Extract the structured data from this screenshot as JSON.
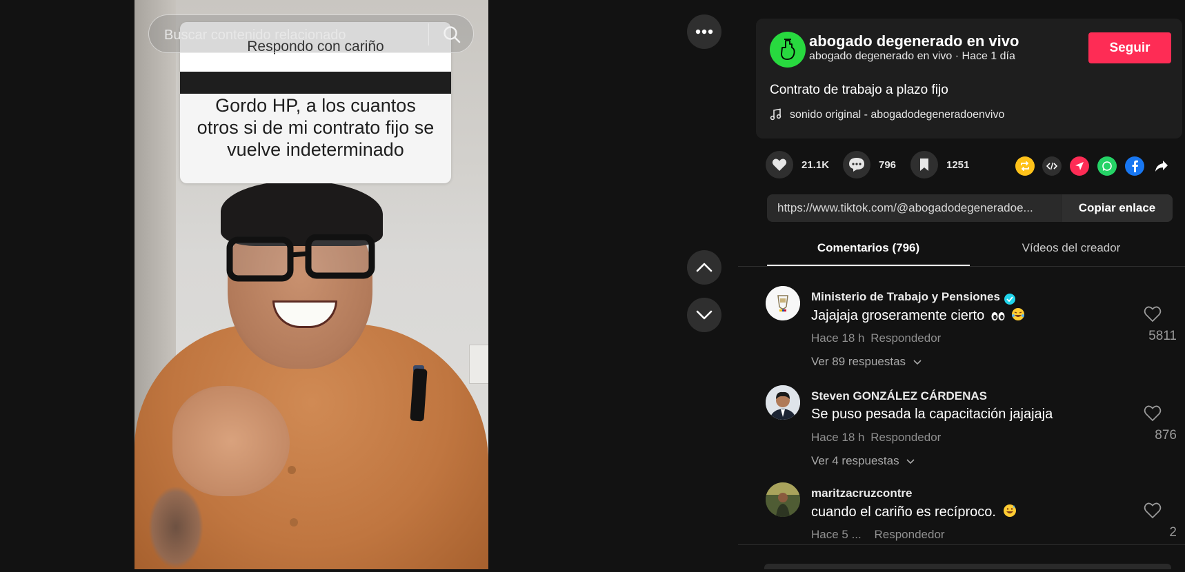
{
  "search": {
    "placeholder": "Buscar contenido relacionado"
  },
  "video": {
    "question_header": "Respondo con cariño",
    "question_text": "Gordo HP, a los cuantos otros si de mi contrato fijo se vuelve indeterminado"
  },
  "creator": {
    "name": "abogado degenerado en vivo",
    "subtitle": "abogado degenerado en vivo · Hace 1 día",
    "follow_label": "Seguir",
    "avatar_color": "#28d93f"
  },
  "post": {
    "description": "Contrato de trabajo a plazo fijo",
    "sound": "sonido original - abogadodegeneradoenvivo"
  },
  "actions": {
    "likes": "21.1K",
    "comments": "796",
    "saves": "1251",
    "share_icons": [
      "repost-icon",
      "embed-icon",
      "send-icon",
      "whatsapp-icon",
      "facebook-icon",
      "share-arrow-icon"
    ]
  },
  "link": {
    "url": "https://www.tiktok.com/@abogadodegeneradoe...",
    "copy_label": "Copiar enlace"
  },
  "tabs": {
    "comments": "Comentarios (796)",
    "creator_videos": "Vídeos del creador"
  },
  "comments": [
    {
      "user": "Ministerio de Trabajo y Pensiones",
      "verified": true,
      "text": "Jajajaja groseramente cierto",
      "emojis": [
        "eyes",
        "laughing-tears"
      ],
      "time": "Hace 18 h",
      "reply_label": "Respondedor",
      "likes": "5811",
      "replies": "Ver 89 respuestas"
    },
    {
      "user": "Steven GONZÁLEZ CÁRDENAS",
      "verified": false,
      "text": "Se puso pesada la capacitación jajajaja",
      "time": "Hace 18 h",
      "reply_label": "Respondedor",
      "likes": "876",
      "replies": "Ver 4 respuestas"
    },
    {
      "user": "maritzacruzcontre",
      "verified": false,
      "text": "cuando el cariño es recíproco.",
      "emojis": [
        "grinning-sweat"
      ],
      "time": "Hace 5 ...",
      "reply_label": "Respondedor",
      "likes": "2"
    }
  ],
  "colors": {
    "accent": "#fe2c55",
    "background": "#121212",
    "card": "#1e1e1e"
  }
}
